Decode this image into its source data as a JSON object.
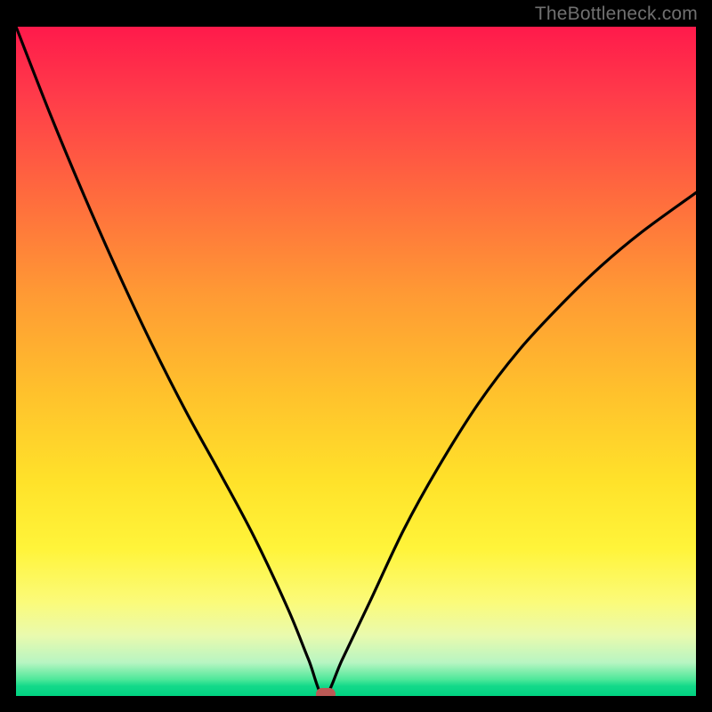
{
  "watermark": "TheBottleneck.com",
  "chart_data": {
    "type": "line",
    "title": "",
    "xlabel": "",
    "ylabel": "",
    "x_range": [
      0,
      1
    ],
    "y_range": [
      0,
      1
    ],
    "curve_min_x": 0.453,
    "curve_points": [
      {
        "x": 0.0,
        "y": 1.0
      },
      {
        "x": 0.05,
        "y": 0.87
      },
      {
        "x": 0.1,
        "y": 0.748
      },
      {
        "x": 0.15,
        "y": 0.633
      },
      {
        "x": 0.2,
        "y": 0.525
      },
      {
        "x": 0.25,
        "y": 0.425
      },
      {
        "x": 0.3,
        "y": 0.333
      },
      {
        "x": 0.35,
        "y": 0.238
      },
      {
        "x": 0.4,
        "y": 0.13
      },
      {
        "x": 0.43,
        "y": 0.055
      },
      {
        "x": 0.453,
        "y": 0.0
      },
      {
        "x": 0.48,
        "y": 0.055
      },
      {
        "x": 0.52,
        "y": 0.14
      },
      {
        "x": 0.57,
        "y": 0.248
      },
      {
        "x": 0.62,
        "y": 0.34
      },
      {
        "x": 0.68,
        "y": 0.437
      },
      {
        "x": 0.74,
        "y": 0.517
      },
      {
        "x": 0.8,
        "y": 0.583
      },
      {
        "x": 0.86,
        "y": 0.642
      },
      {
        "x": 0.92,
        "y": 0.693
      },
      {
        "x": 1.0,
        "y": 0.752
      }
    ],
    "marker": {
      "x": 0.455,
      "y": 0.002,
      "color": "#bb5a56"
    },
    "background_gradient": {
      "type": "linear-vertical",
      "stops": [
        {
          "pos": 0.0,
          "color": "#ff1a4b"
        },
        {
          "pos": 0.25,
          "color": "#ff6a3e"
        },
        {
          "pos": 0.55,
          "color": "#ffc22c"
        },
        {
          "pos": 0.78,
          "color": "#fff43a"
        },
        {
          "pos": 0.93,
          "color": "#c9f7bd"
        },
        {
          "pos": 1.0,
          "color": "#00d281"
        }
      ]
    }
  }
}
